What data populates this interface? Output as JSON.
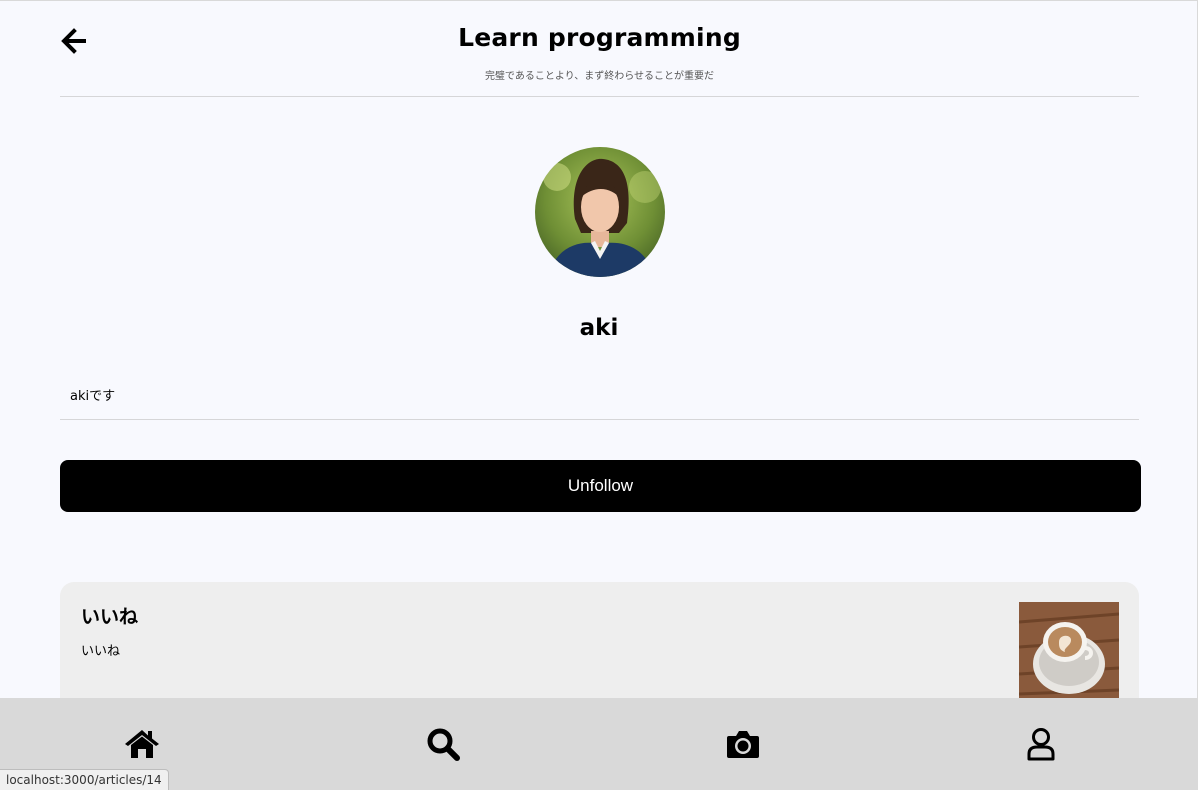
{
  "header": {
    "title": "Learn programming",
    "subtitle": "完璧であることより、まず終わらせることが重要だ",
    "back_icon": "arrow-left-icon"
  },
  "profile": {
    "username": "aki",
    "bio": "akiです",
    "avatar": "profile-photo"
  },
  "actions": {
    "unfollow_label": "Unfollow"
  },
  "articles": [
    {
      "title": "いいね",
      "body": "いいね",
      "thumbnail": "coffee-cup-photo"
    }
  ],
  "bottom_nav": {
    "items": [
      "home-icon",
      "search-icon",
      "camera-icon",
      "user-icon"
    ]
  },
  "status_bar": {
    "url": "localhost:3000/articles/14"
  }
}
